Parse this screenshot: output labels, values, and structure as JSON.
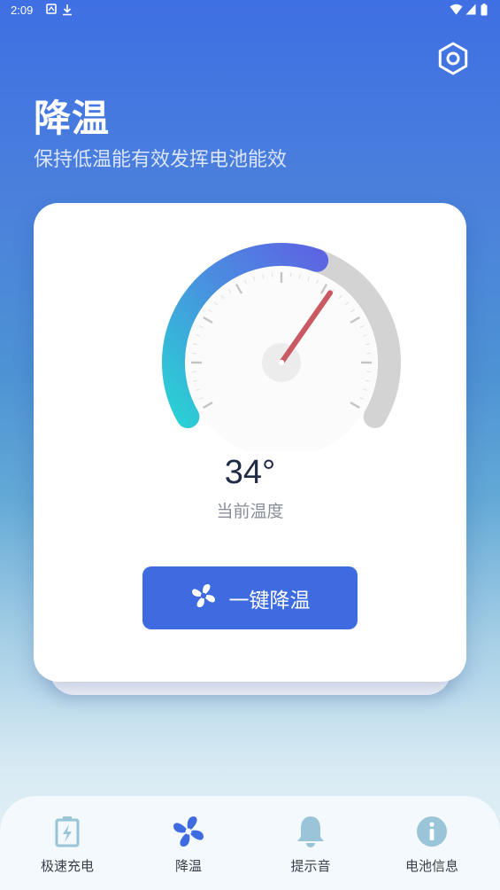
{
  "status_bar": {
    "time": "2:09"
  },
  "header": {
    "title": "降温",
    "subtitle": "保持低温能有效发挥电池能效"
  },
  "gauge": {
    "temperature_display": "34°",
    "temperature_value": 34,
    "label": "当前温度",
    "colors": {
      "start": "#2ad0d4",
      "mid": "#4a8ee0",
      "end": "#5c66e3",
      "track": "#d3d3d3",
      "needle": "#c95a63"
    }
  },
  "actions": {
    "cool_button_label": "一键降温"
  },
  "nav": {
    "items": [
      {
        "label": "极速充电",
        "icon": "battery-charging-icon"
      },
      {
        "label": "降温",
        "icon": "fan-icon"
      },
      {
        "label": "提示音",
        "icon": "bell-icon"
      },
      {
        "label": "电池信息",
        "icon": "info-icon"
      }
    ],
    "active_index": 1,
    "colors": {
      "active": "#3f6be0",
      "inactive": "#9ac4d8"
    }
  }
}
